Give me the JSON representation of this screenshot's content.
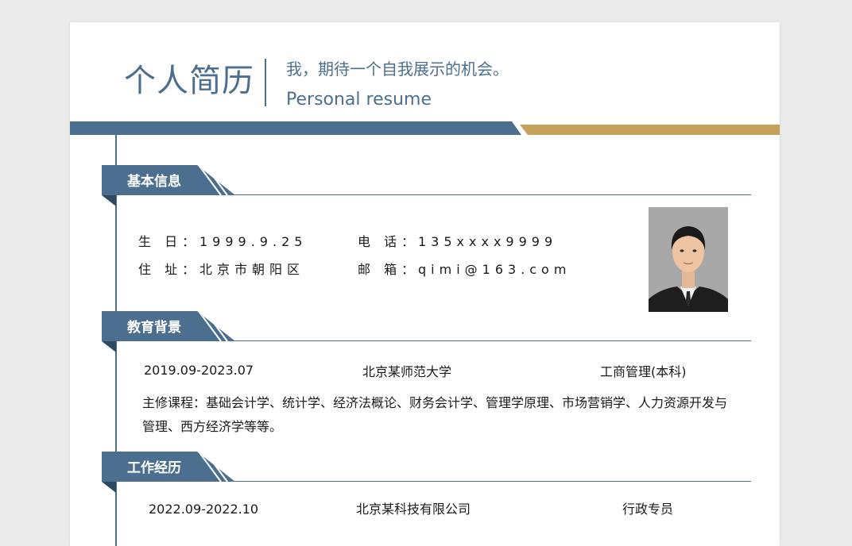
{
  "header": {
    "title": "个人简历",
    "slogan": "我，期待一个自我展示的机会。",
    "subtitle": "Personal resume"
  },
  "colors": {
    "primary": "#4d6f8f",
    "accent": "#c4a05a",
    "background": "#ebebeb",
    "paper": "#ffffff"
  },
  "basic_info": {
    "section_title": "基本信息",
    "birthday_label": "生 日：",
    "birthday_value": "1999.9.25",
    "phone_label": "电 话：",
    "phone_value": "135xxxx9999",
    "address_label": "住 址：",
    "address_value": "北京市朝阳区",
    "email_label": "邮 箱：",
    "email_value": "qimi@163.com",
    "photo_icon": "profile-photo"
  },
  "education": {
    "section_title": "教育背景",
    "period": "2019.09-2023.07",
    "school": "北京某师范大学",
    "major": "工商管理(本科)",
    "courses": "主修课程：基础会计学、统计学、经济法概论、财务会计学、管理学原理、市场营销学、人力资源开发与管理、西方经济学等等。"
  },
  "work": {
    "section_title": "工作经历",
    "period": "2022.09-2022.10",
    "company": "北京某科技有限公司",
    "position": "行政专员"
  }
}
